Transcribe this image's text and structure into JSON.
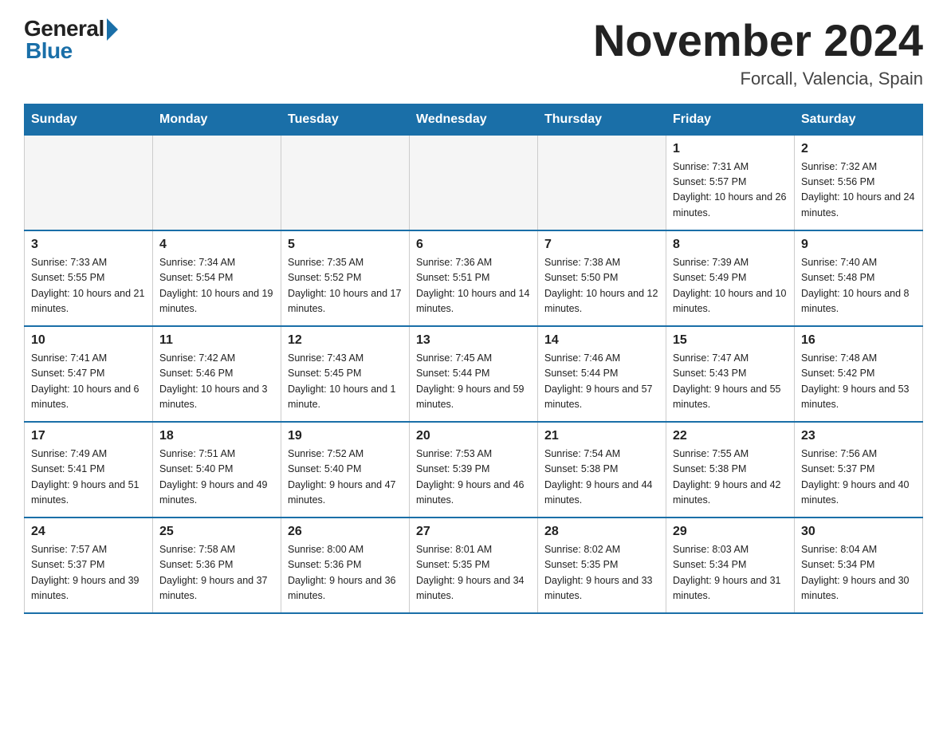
{
  "logo": {
    "general": "General",
    "blue": "Blue"
  },
  "title": "November 2024",
  "location": "Forcall, Valencia, Spain",
  "days_of_week": [
    "Sunday",
    "Monday",
    "Tuesday",
    "Wednesday",
    "Thursday",
    "Friday",
    "Saturday"
  ],
  "weeks": [
    [
      {
        "day": "",
        "sunrise": "",
        "sunset": "",
        "daylight": ""
      },
      {
        "day": "",
        "sunrise": "",
        "sunset": "",
        "daylight": ""
      },
      {
        "day": "",
        "sunrise": "",
        "sunset": "",
        "daylight": ""
      },
      {
        "day": "",
        "sunrise": "",
        "sunset": "",
        "daylight": ""
      },
      {
        "day": "",
        "sunrise": "",
        "sunset": "",
        "daylight": ""
      },
      {
        "day": "1",
        "sunrise": "Sunrise: 7:31 AM",
        "sunset": "Sunset: 5:57 PM",
        "daylight": "Daylight: 10 hours and 26 minutes."
      },
      {
        "day": "2",
        "sunrise": "Sunrise: 7:32 AM",
        "sunset": "Sunset: 5:56 PM",
        "daylight": "Daylight: 10 hours and 24 minutes."
      }
    ],
    [
      {
        "day": "3",
        "sunrise": "Sunrise: 7:33 AM",
        "sunset": "Sunset: 5:55 PM",
        "daylight": "Daylight: 10 hours and 21 minutes."
      },
      {
        "day": "4",
        "sunrise": "Sunrise: 7:34 AM",
        "sunset": "Sunset: 5:54 PM",
        "daylight": "Daylight: 10 hours and 19 minutes."
      },
      {
        "day": "5",
        "sunrise": "Sunrise: 7:35 AM",
        "sunset": "Sunset: 5:52 PM",
        "daylight": "Daylight: 10 hours and 17 minutes."
      },
      {
        "day": "6",
        "sunrise": "Sunrise: 7:36 AM",
        "sunset": "Sunset: 5:51 PM",
        "daylight": "Daylight: 10 hours and 14 minutes."
      },
      {
        "day": "7",
        "sunrise": "Sunrise: 7:38 AM",
        "sunset": "Sunset: 5:50 PM",
        "daylight": "Daylight: 10 hours and 12 minutes."
      },
      {
        "day": "8",
        "sunrise": "Sunrise: 7:39 AM",
        "sunset": "Sunset: 5:49 PM",
        "daylight": "Daylight: 10 hours and 10 minutes."
      },
      {
        "day": "9",
        "sunrise": "Sunrise: 7:40 AM",
        "sunset": "Sunset: 5:48 PM",
        "daylight": "Daylight: 10 hours and 8 minutes."
      }
    ],
    [
      {
        "day": "10",
        "sunrise": "Sunrise: 7:41 AM",
        "sunset": "Sunset: 5:47 PM",
        "daylight": "Daylight: 10 hours and 6 minutes."
      },
      {
        "day": "11",
        "sunrise": "Sunrise: 7:42 AM",
        "sunset": "Sunset: 5:46 PM",
        "daylight": "Daylight: 10 hours and 3 minutes."
      },
      {
        "day": "12",
        "sunrise": "Sunrise: 7:43 AM",
        "sunset": "Sunset: 5:45 PM",
        "daylight": "Daylight: 10 hours and 1 minute."
      },
      {
        "day": "13",
        "sunrise": "Sunrise: 7:45 AM",
        "sunset": "Sunset: 5:44 PM",
        "daylight": "Daylight: 9 hours and 59 minutes."
      },
      {
        "day": "14",
        "sunrise": "Sunrise: 7:46 AM",
        "sunset": "Sunset: 5:44 PM",
        "daylight": "Daylight: 9 hours and 57 minutes."
      },
      {
        "day": "15",
        "sunrise": "Sunrise: 7:47 AM",
        "sunset": "Sunset: 5:43 PM",
        "daylight": "Daylight: 9 hours and 55 minutes."
      },
      {
        "day": "16",
        "sunrise": "Sunrise: 7:48 AM",
        "sunset": "Sunset: 5:42 PM",
        "daylight": "Daylight: 9 hours and 53 minutes."
      }
    ],
    [
      {
        "day": "17",
        "sunrise": "Sunrise: 7:49 AM",
        "sunset": "Sunset: 5:41 PM",
        "daylight": "Daylight: 9 hours and 51 minutes."
      },
      {
        "day": "18",
        "sunrise": "Sunrise: 7:51 AM",
        "sunset": "Sunset: 5:40 PM",
        "daylight": "Daylight: 9 hours and 49 minutes."
      },
      {
        "day": "19",
        "sunrise": "Sunrise: 7:52 AM",
        "sunset": "Sunset: 5:40 PM",
        "daylight": "Daylight: 9 hours and 47 minutes."
      },
      {
        "day": "20",
        "sunrise": "Sunrise: 7:53 AM",
        "sunset": "Sunset: 5:39 PM",
        "daylight": "Daylight: 9 hours and 46 minutes."
      },
      {
        "day": "21",
        "sunrise": "Sunrise: 7:54 AM",
        "sunset": "Sunset: 5:38 PM",
        "daylight": "Daylight: 9 hours and 44 minutes."
      },
      {
        "day": "22",
        "sunrise": "Sunrise: 7:55 AM",
        "sunset": "Sunset: 5:38 PM",
        "daylight": "Daylight: 9 hours and 42 minutes."
      },
      {
        "day": "23",
        "sunrise": "Sunrise: 7:56 AM",
        "sunset": "Sunset: 5:37 PM",
        "daylight": "Daylight: 9 hours and 40 minutes."
      }
    ],
    [
      {
        "day": "24",
        "sunrise": "Sunrise: 7:57 AM",
        "sunset": "Sunset: 5:37 PM",
        "daylight": "Daylight: 9 hours and 39 minutes."
      },
      {
        "day": "25",
        "sunrise": "Sunrise: 7:58 AM",
        "sunset": "Sunset: 5:36 PM",
        "daylight": "Daylight: 9 hours and 37 minutes."
      },
      {
        "day": "26",
        "sunrise": "Sunrise: 8:00 AM",
        "sunset": "Sunset: 5:36 PM",
        "daylight": "Daylight: 9 hours and 36 minutes."
      },
      {
        "day": "27",
        "sunrise": "Sunrise: 8:01 AM",
        "sunset": "Sunset: 5:35 PM",
        "daylight": "Daylight: 9 hours and 34 minutes."
      },
      {
        "day": "28",
        "sunrise": "Sunrise: 8:02 AM",
        "sunset": "Sunset: 5:35 PM",
        "daylight": "Daylight: 9 hours and 33 minutes."
      },
      {
        "day": "29",
        "sunrise": "Sunrise: 8:03 AM",
        "sunset": "Sunset: 5:34 PM",
        "daylight": "Daylight: 9 hours and 31 minutes."
      },
      {
        "day": "30",
        "sunrise": "Sunrise: 8:04 AM",
        "sunset": "Sunset: 5:34 PM",
        "daylight": "Daylight: 9 hours and 30 minutes."
      }
    ]
  ]
}
